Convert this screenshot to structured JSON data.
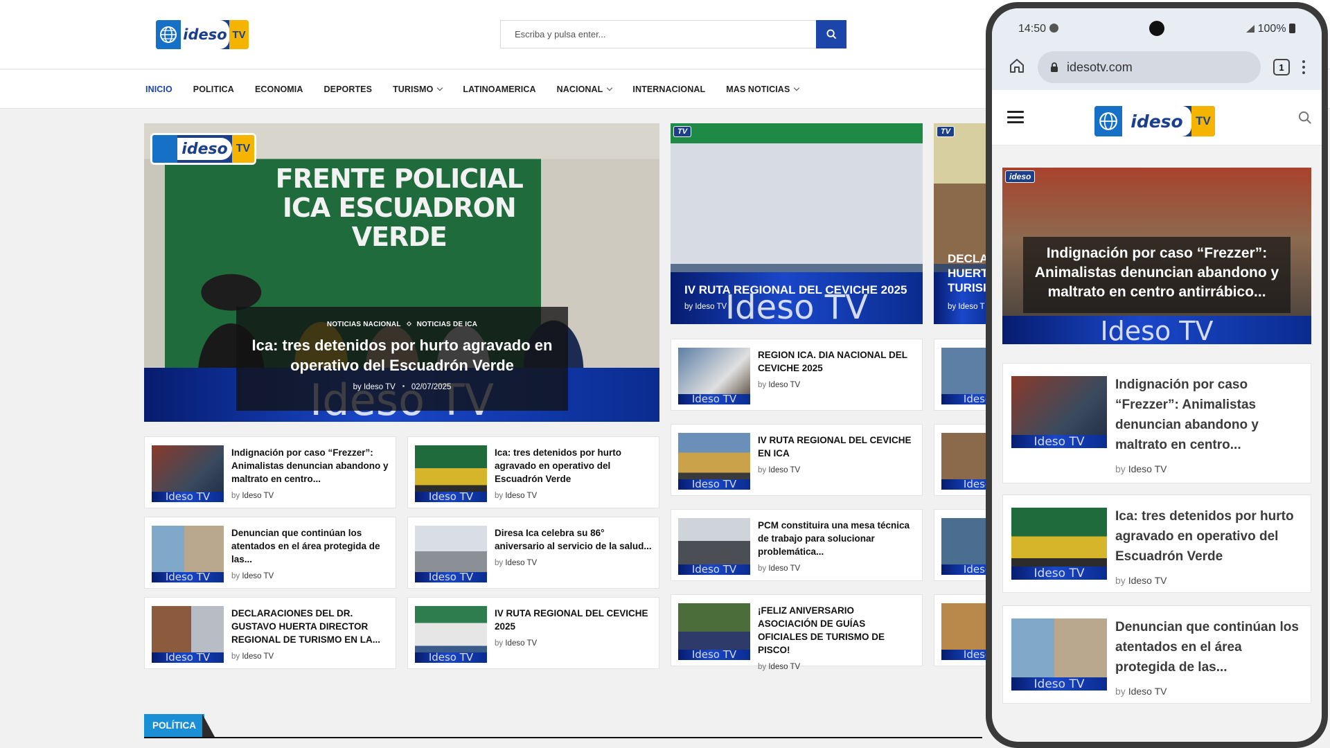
{
  "header": {
    "logo_text": "ideso",
    "logo_tv": "TV",
    "search_placeholder": "Escriba y pulsa enter..."
  },
  "nav": {
    "items": [
      {
        "label": "INICIO",
        "active": true
      },
      {
        "label": "POLITICA"
      },
      {
        "label": "ECONOMIA"
      },
      {
        "label": "DEPORTES"
      },
      {
        "label": "TURISMO",
        "dropdown": true
      },
      {
        "label": "LATINOAMERICA"
      },
      {
        "label": "NACIONAL",
        "dropdown": true
      },
      {
        "label": "INTERNACIONAL"
      },
      {
        "label": "MAS NOTICIAS",
        "dropdown": true
      }
    ]
  },
  "hero": {
    "image_banner": "FRENTE POLICIAL ICA ESCUADRON VERDE",
    "watermark": "Ideso TV",
    "category_1": "NOTICIAS NACIONAL",
    "category_2": "NOTICIAS DE ICA",
    "title": "Ica: tres detenidos por hurto agravado en operativo del Escuadrón Verde",
    "author_prefix": "by",
    "author": "Ideso TV",
    "date": "02/07/2025"
  },
  "grid_left": [
    {
      "title": "Indignación por caso “Frezzer”: Animalistas denuncian abandono y maltrato en centro...",
      "author": "Ideso TV"
    },
    {
      "title": "Ica: tres detenidos por hurto agravado en operativo del Escuadrón Verde",
      "author": "Ideso TV"
    },
    {
      "title": "Denuncian que continúan los atentados en el área protegida de las...",
      "author": "Ideso TV"
    },
    {
      "title": "Diresa Ica celebra su 86° aniversario al servicio de la salud...",
      "author": "Ideso TV"
    },
    {
      "title": "DECLARACIONES DEL DR. GUSTAVO HUERTA DIRECTOR REGIONAL DE TURISMO EN LA...",
      "author": "Ideso TV"
    },
    {
      "title": "IV RUTA REGIONAL DEL CEVICHE 2025",
      "author": "Ideso TV"
    }
  ],
  "middle": {
    "feature": {
      "title": "IV RUTA REGIONAL DEL CEVICHE 2025",
      "author": "Ideso TV",
      "watermark": "Ideso TV"
    },
    "list": [
      {
        "title": "REGION ICA. DIA NACIONAL DEL CEVICHE 2025",
        "author": "Ideso TV"
      },
      {
        "title": "IV RUTA REGIONAL DEL CEVICHE EN ICA",
        "author": "Ideso TV"
      },
      {
        "title": "PCM constituira una mesa técnica de trabajo para solucionar problemática...",
        "author": "Ideso TV"
      },
      {
        "title": "¡FELIZ ANIVERSARIO ASOCIACIÓN DE GUÍAS OFICIALES DE TURISMO DE PISCO!",
        "author": "Ideso TV"
      }
    ]
  },
  "right_partial": {
    "feature_title": "DECLA HUERT TURISI",
    "feature_author": "by Ideso T",
    "thumb_watermark": "Ideso"
  },
  "section": {
    "label": "POLÍTICA"
  },
  "common": {
    "by": "by",
    "thumb_watermark": "Ideso TV",
    "chip": "TV"
  },
  "phone": {
    "time": "14:50",
    "battery": "100%",
    "url": "idesotv.com",
    "tabs_count": "1",
    "hero_title": "Indignación por caso “Frezzer”: Animalistas denuncian abandono y maltrato en centro antirrábico...",
    "hero_watermark": "Ideso TV",
    "cards": [
      {
        "title": "Indignación por caso “Frezzer”: Animalistas denuncian abandono y maltrato en centro...",
        "author": "Ideso TV"
      },
      {
        "title": "Ica: tres detenidos por hurto agravado en operativo del Escuadrón Verde",
        "author": "Ideso TV"
      },
      {
        "title": "Denuncian que continúan los atentados en el área protegida de las...",
        "author": "Ideso TV"
      }
    ]
  },
  "colors": {
    "accent": "#1b45a8",
    "section_tag": "#1b8fd6",
    "brand_blue": "#1b3f8a",
    "brand_yellow": "#f4b400"
  },
  "icons": {
    "search": "search-icon",
    "home": "home-icon",
    "lock": "lock-icon",
    "menu": "hamburger-icon",
    "more": "kebab-menu-icon"
  }
}
